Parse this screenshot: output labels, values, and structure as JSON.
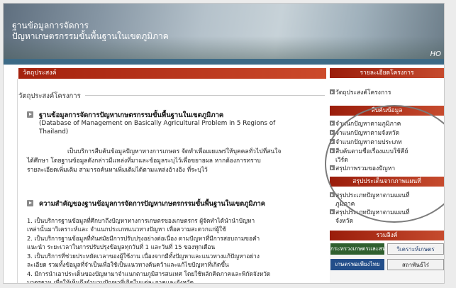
{
  "banner": {
    "title_line1": "ฐานข้อมูลการจัดการ",
    "title_line2": "ปัญหาเกษตรกรรมขั้นพื้นฐานในเขตภูมิภาค",
    "home_text": "HO"
  },
  "main": {
    "header": "วัตถุประสงค์",
    "section_title": "วัตถุประสงค์โครงการ",
    "heading1": "ฐานข้อมูลการจัดการปัญหาเกษตรกรรมขั้นพื้นฐานในเขตภูมิภาค",
    "heading1_en_line1": "(Database of Management on Basically Agricultural Problem in 5 Regions of",
    "heading1_en_line2": "Thailand)",
    "para1_line1": "เป็นบริการสืบค้นข้อมูลปัญหาทางการเกษตร จัดทำเพื่อเผยแพร่ให้บุคคลทั่วไปที่สนใจ",
    "para1_line2": "ได้ศึกษา โดยฐานข้อมูลดังกล่าวมีแหล่งที่มาและข้อมูลระบุไว้เพื่อขยายผล หากต้องการทราบ",
    "para1_line3": "รายละเอียดเพิ่มเติม สามารถค้นหาเพิ่มเติมได้ตามแหล่งอ้างอิง ที่ระบุไว้",
    "heading2": "ความสำคัญของฐานข้อมูลการจัดการปัญหาเกษตรกรรมขั้นพื้นฐานในเขตภูมิภาค",
    "list": [
      {
        "l1": "1. เป็นบริการฐานข้อมูลที่ศึกษาถึงปัญหาทางการเกษตรของเกษตรกร ผู้จัดทำได้นำนำปัญหา",
        "l2": "    เหล่านั้นมาวิเคราะห์และ จำแนกประเภทแนวทางปัญหา เพื่อความสะดวกแก่ผู้ใช้"
      },
      {
        "l1": "2. เป็นบริการฐานข้อมูลที่ทันสมัยมีการปรับปรุงอย่างต่อเนื่อง ตามปัญหาที่มีการสอบถามขอคำ",
        "l2": "    แนะนำ ระยะเวลาในการปรับปรุงข้อมูลทุกวันที่ 1 และวันที่ 15 ของทุกเดือน"
      },
      {
        "l1": "3. เป็นบริการที่ช่วยประหยัดเวลาของผู้ใช้งาน  เนื่องจากมีทั้งปัญหาและแนวทางแก้ปัญหาอย่าง",
        "l2": "    ละเอียด รวมทั้งข้อมูลที่จำเป็นเพื่อใช้เป็นแนวทางค้นคว้าและแก้ไขปัญหาที่เกิดขึ้น"
      },
      {
        "l1": "4. มีการนำเอาประเด็นของปัญหามาจำแนกตามภูมิสารสนเทศ โดยใช้หลักคิดภาคและพิกัดจังหวัด",
        "l2": "    มาตรฐาน เพื่อให้เห็นถึงจำนวนปัญหาที่เกิดในแต่ละภาคและจังหวัด"
      }
    ]
  },
  "sidebar": {
    "project_header": "รายละเอียดโครงการ",
    "project_item": "วัตถุประสงค์โครงการ",
    "search_header": "สืบค้นข้อมูล",
    "search_items": [
      "จำแนกปัญหาตามภูมิภาค",
      "จำแนกปัญหาตามจังหวัด",
      "จำแนกปัญหาตามประเภท",
      "สืบค้นตามชื่อเรื่องแบบใช้คีย์",
      "เวิร์ด",
      "สรุปภาพรวมของปัญหา"
    ],
    "map_header": "สรุปประเด็นจากภาพแผนที่",
    "map_items": [
      "สรุปประเภทปัญหาตามแผนที่",
      "ภูมิภาค",
      "สรุปประเภทปัญหาตามแผนที่",
      "จังหวัด"
    ],
    "links_header": "รวมลิงค์",
    "links": [
      "กระทรวงเกษตรและสหกรณ์",
      "วิเคราะห์เกษตร",
      "เกษตรพอเพียงไทย",
      "สถาพันธ์ไร่"
    ]
  },
  "colors": {
    "header_red": "#a4210d",
    "banner_bar": "#3d6a86"
  }
}
